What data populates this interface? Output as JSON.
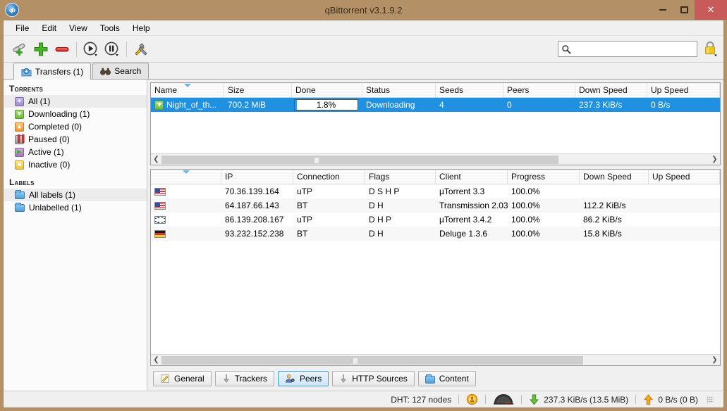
{
  "window": {
    "title": "qBittorrent v3.1.9.2",
    "logo_text": "qb",
    "minimize_label": "–",
    "maximize_label": "☐",
    "close_label": "✕"
  },
  "menubar": {
    "items": [
      {
        "label": "File"
      },
      {
        "label": "Edit"
      },
      {
        "label": "View"
      },
      {
        "label": "Tools"
      },
      {
        "label": "Help"
      }
    ]
  },
  "toolbar": {
    "buttons": [
      {
        "name": "add-torrent-link-button",
        "icon": "link-plus-icon",
        "label": "Add Torrent Link"
      },
      {
        "name": "add-torrent-file-button",
        "icon": "plus-icon",
        "label": "Add Torrent File"
      },
      {
        "name": "delete-button",
        "icon": "minus-icon",
        "label": "Delete"
      },
      {
        "name": "resume-button",
        "icon": "play-icon",
        "label": "Resume"
      },
      {
        "name": "pause-button",
        "icon": "pause-icon",
        "label": "Pause"
      },
      {
        "name": "options-button",
        "icon": "tools-icon",
        "label": "Options"
      }
    ],
    "search": {
      "value": "",
      "placeholder": "",
      "icon": "search-icon"
    },
    "lock": {
      "icon": "lock-icon",
      "label": "Lock qBittorrent"
    }
  },
  "tabs": [
    {
      "label": "Transfers (1)",
      "icon": "transfers-icon",
      "active": true
    },
    {
      "label": "Search",
      "icon": "binoculars-icon",
      "active": false
    }
  ],
  "sidebar": {
    "torrents_header": "Torrents",
    "torrents": [
      {
        "label": "All (1)",
        "icon": "all-icon",
        "selected": true
      },
      {
        "label": "Downloading (1)",
        "icon": "downloading-icon",
        "selected": false
      },
      {
        "label": "Completed (0)",
        "icon": "completed-icon",
        "selected": false
      },
      {
        "label": "Paused (0)",
        "icon": "paused-icon",
        "selected": false
      },
      {
        "label": "Active (1)",
        "icon": "active-icon",
        "selected": false
      },
      {
        "label": "Inactive (0)",
        "icon": "inactive-icon",
        "selected": false
      }
    ],
    "labels_header": "Labels",
    "labels": [
      {
        "label": "All labels (1)",
        "icon": "folder-icon",
        "selected": true
      },
      {
        "label": "Unlabelled (1)",
        "icon": "folder-icon",
        "selected": false
      }
    ]
  },
  "torrent_table": {
    "columns": [
      "Name",
      "Size",
      "Done",
      "Status",
      "Seeds",
      "Peers",
      "Down Speed",
      "Up Speed"
    ],
    "sorted_column": "Name",
    "rows": [
      {
        "name": "Night_of_th...",
        "size": "700.2 MiB",
        "done": "1.8%",
        "done_pct": 1.8,
        "status": "Downloading",
        "seeds": "4",
        "peers": "0",
        "down_speed": "237.3 KiB/s",
        "up_speed": "0 B/s",
        "selected": true,
        "icon": "downloading-icon"
      }
    ],
    "hscroll": {
      "position": 0.39
    }
  },
  "peers_table": {
    "columns": [
      "",
      "IP",
      "Connection",
      "Flags",
      "Client",
      "Progress",
      "Down Speed",
      "Up Speed"
    ],
    "rows": [
      {
        "flag": "us",
        "ip": "70.36.139.164",
        "connection": "uTP",
        "flags": "D S H P",
        "client": "µTorrent 3.3",
        "progress": "100.0%",
        "down_speed": "",
        "up_speed": ""
      },
      {
        "flag": "us",
        "ip": "64.187.66.143",
        "connection": "BT",
        "flags": "D H",
        "client": "Transmission 2.03",
        "progress": "100.0%",
        "down_speed": "112.2 KiB/s",
        "up_speed": ""
      },
      {
        "flag": "gb",
        "ip": "86.139.208.167",
        "connection": "uTP",
        "flags": "D H P",
        "client": "µTorrent 3.4.2",
        "progress": "100.0%",
        "down_speed": "86.2 KiB/s",
        "up_speed": ""
      },
      {
        "flag": "de",
        "ip": "93.232.152.238",
        "connection": "BT",
        "flags": "D H",
        "client": "Deluge 1.3.6",
        "progress": "100.0%",
        "down_speed": "15.8 KiB/s",
        "up_speed": ""
      }
    ],
    "hscroll": {
      "position": 0.46
    }
  },
  "bottom_tabs": [
    {
      "label": "General",
      "icon": "pencil-note-icon",
      "active": false
    },
    {
      "label": "Trackers",
      "icon": "tracker-icon",
      "active": false
    },
    {
      "label": "Peers",
      "icon": "peers-icon",
      "active": true
    },
    {
      "label": "HTTP Sources",
      "icon": "tracker-icon",
      "active": false
    },
    {
      "label": "Content",
      "icon": "folder-icon",
      "active": false
    }
  ],
  "statusbar": {
    "dht": "DHT: 127 nodes",
    "connection_icon": "connection-status-icon",
    "speed_icon": "speedometer-icon",
    "download": "237.3 KiB/s (13.5 MiB)",
    "upload": "0 B/s (0 B)"
  },
  "colors": {
    "titlebar": "#b49067",
    "close_button": "#c85a5a",
    "selection": "#2091e0",
    "accent": "#3a96e8"
  }
}
